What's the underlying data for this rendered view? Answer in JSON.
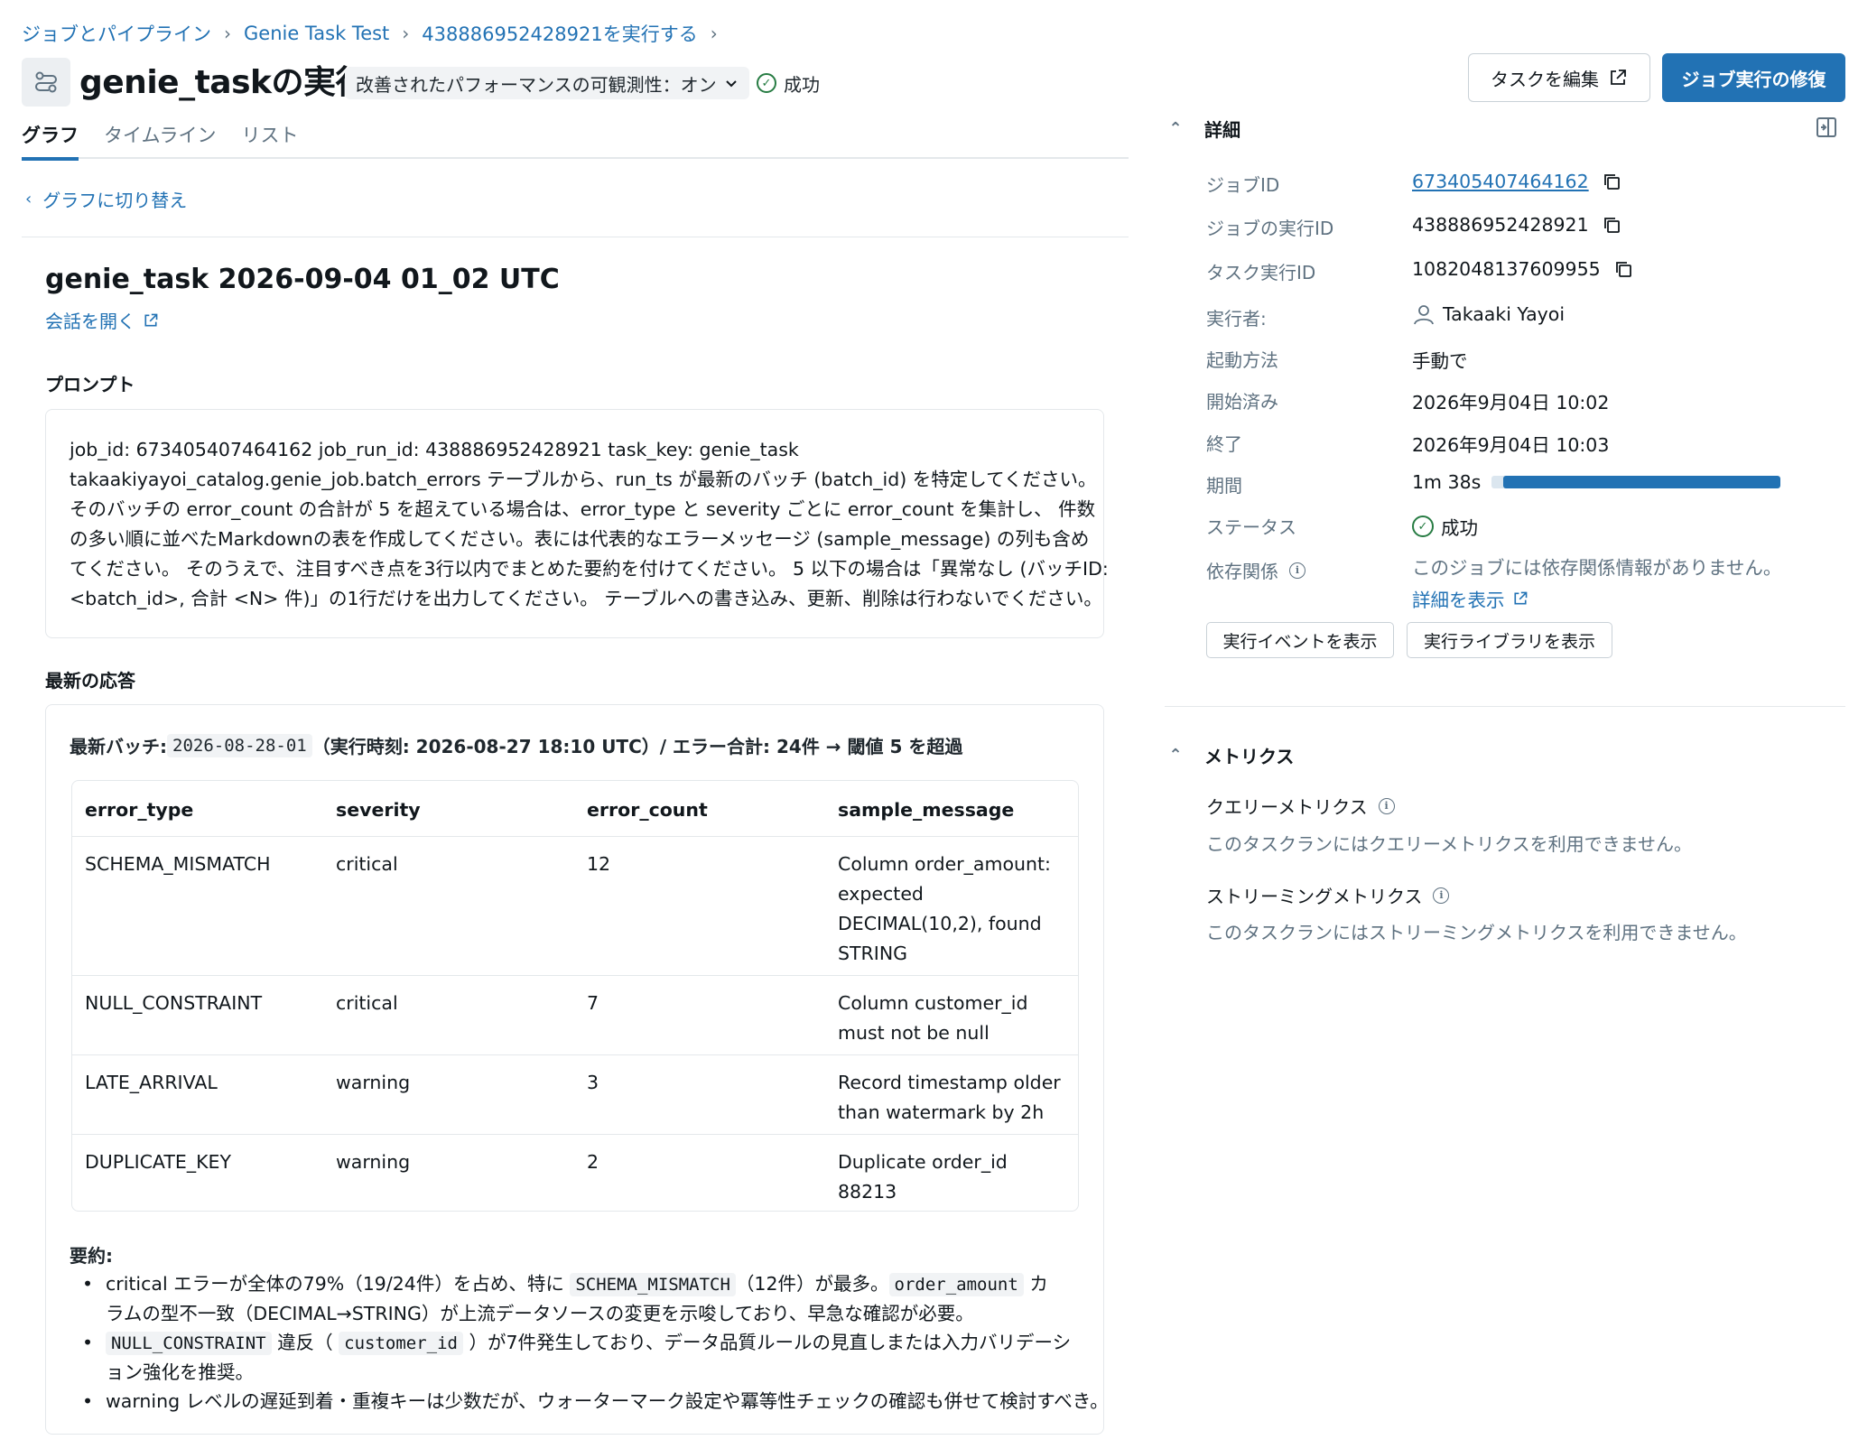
{
  "breadcrumb": [
    "ジョブとパイプライン",
    "Genie Task Test",
    "438886952428921を実行する"
  ],
  "header": {
    "title": "genie_taskの実行",
    "perf_toggle": "改善されたパフォーマンスの可観測性：オン",
    "status": "成功",
    "edit_task": "タスクを編集",
    "repair_run": "ジョブ実行の修復"
  },
  "tabs": [
    "グラフ",
    "タイムライン",
    "リスト"
  ],
  "switch_graph": "グラフに切り替え",
  "run_title": "genie_task 2026-09-04 01_02 UTC",
  "open_conversation": "会話を開く",
  "prompt": {
    "label": "プロンプト",
    "lines": [
      "job_id: 673405407464162 job_run_id: 438886952428921 task_key: genie_task",
      "takaakiyayoi_catalog.genie_job.batch_errors テーブルから、run_ts が最新のバッチ (batch_id) を特定してください。",
      "そのバッチの error_count の合計が 5 を超えている場合は、error_type と severity ごとに error_count を集計し、 件数",
      "の多い順に並べたMarkdownの表を作成してください。表には代表的なエラーメッセージ (sample_message) の列も含め",
      "てください。 そのうえで、注目すべき点を3行以内でまとめた要約を付けてください。 5 以下の場合は「異常なし (バッチID:",
      "<batch_id>, 合計 <N> 件)」の1行だけを出力してください。 テーブルへの書き込み、更新、削除は行わないでください。"
    ]
  },
  "response": {
    "label": "最新の応答",
    "head_prefix": "最新バッチ: ",
    "head_batch": "2026-08-28-01",
    "head_suffix": "（実行時刻: 2026-08-27 18:10 UTC）/ エラー合計: 24件 → 閾値 5 を超過",
    "table": {
      "columns": [
        "error_type",
        "severity",
        "error_count",
        "sample_message"
      ],
      "rows": [
        {
          "error_type": "SCHEMA_MISMATCH",
          "severity": "critical",
          "error_count": "12",
          "sample_message": [
            "Column order_amount:",
            "expected",
            "DECIMAL(10,2), found",
            "STRING"
          ]
        },
        {
          "error_type": "NULL_CONSTRAINT",
          "severity": "critical",
          "error_count": "7",
          "sample_message": [
            "Column customer_id",
            "must not be null"
          ]
        },
        {
          "error_type": "LATE_ARRIVAL",
          "severity": "warning",
          "error_count": "3",
          "sample_message": [
            "Record timestamp older",
            "than watermark by 2h"
          ]
        },
        {
          "error_type": "DUPLICATE_KEY",
          "severity": "warning",
          "error_count": "2",
          "sample_message": [
            "Duplicate order_id",
            "88213"
          ]
        }
      ]
    },
    "summary_label": "要約:",
    "bullets": [
      {
        "l1a": "critical エラーが全体の79%（19/24件）を占め、特に ",
        "l1code": "SCHEMA_MISMATCH",
        "l1b": "（12件）が最多。",
        "l1code2": "order_amount",
        "l1c": " カ",
        "l2": "ラムの型不一致（DECIMAL→STRING）が上流データソースの変更を示唆しており、早急な確認が必要。"
      },
      {
        "l1code": "NULL_CONSTRAINT",
        "l1a": " 違反（ ",
        "l1code2": "customer_id",
        "l1b": " ）が7件発生しており、データ品質ルールの見直しまたは入力バリデーシ",
        "l2": "ョン強化を推奨。"
      },
      {
        "l1": "warning レベルの遅延到着・重複キーは少数だが、ウォーターマーク設定や冪等性チェックの確認も併せて検討すべき。"
      }
    ]
  },
  "details": {
    "label": "詳細",
    "job_id_key": "ジョブID",
    "job_id": "673405407464162",
    "job_run_id_key": "ジョブの実行ID",
    "job_run_id": "438886952428921",
    "task_run_id_key": "タスク実行ID",
    "task_run_id": "1082048137609955",
    "run_by_key": "実行者:",
    "run_by": "Takaaki Yayoi",
    "launched_key": "起動方法",
    "launched": "手動で",
    "started_key": "開始済み",
    "started": "2026年9月04日 10:02",
    "ended_key": "終了",
    "ended": "2026年9月04日 10:03",
    "duration_key": "期間",
    "duration": "1m 38s",
    "duration_progress": 0.96,
    "status_key": "ステータス",
    "status": "成功",
    "deps_key": "依存関係",
    "deps": "このジョブには依存関係情報がありません。",
    "deps_link": "詳細を表示",
    "btn_events": "実行イベントを表示",
    "btn_libraries": "実行ライブラリを表示"
  },
  "metrics": {
    "label": "メトリクス",
    "query_label": "クエリーメトリクス",
    "query_note": "このタスクランにはクエリーメトリクスを利用できません。",
    "stream_label": "ストリーミングメトリクス",
    "stream_note": "このタスクランにはストリーミングメトリクスを利用できません。"
  },
  "colors": {
    "accent": "#2272b4",
    "success": "#277c43",
    "muted": "#5f7281"
  }
}
